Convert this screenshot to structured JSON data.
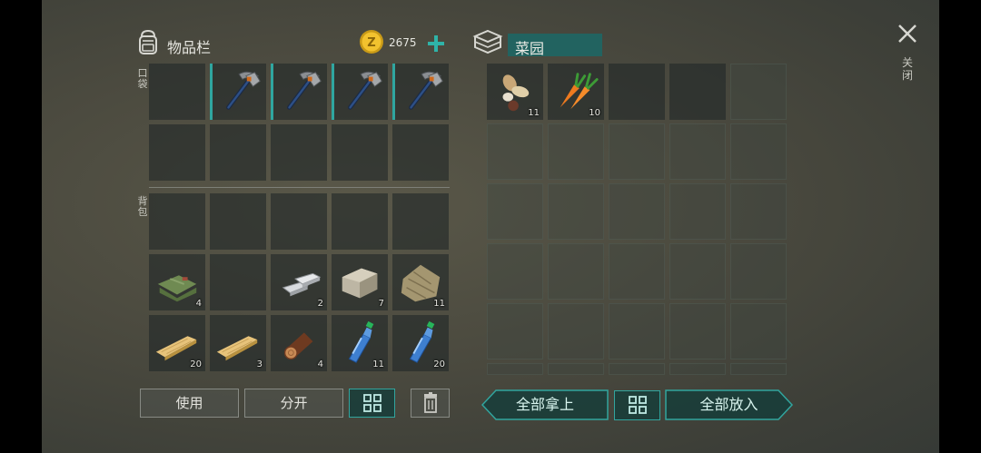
{
  "inventory": {
    "title": "物品栏",
    "currency_amount": "2675",
    "pocket_label": "口袋",
    "backpack_label": "背包",
    "pocket_slots": [
      {
        "item": "",
        "count": ""
      },
      {
        "item": "pickaxe",
        "count": ""
      },
      {
        "item": "pickaxe",
        "count": ""
      },
      {
        "item": "pickaxe",
        "count": ""
      },
      {
        "item": "pickaxe",
        "count": ""
      },
      {
        "item": "",
        "count": ""
      },
      {
        "item": "",
        "count": ""
      },
      {
        "item": "",
        "count": ""
      },
      {
        "item": "",
        "count": ""
      },
      {
        "item": "",
        "count": ""
      }
    ],
    "backpack_slots": [
      {
        "item": "",
        "count": ""
      },
      {
        "item": "",
        "count": ""
      },
      {
        "item": "",
        "count": ""
      },
      {
        "item": "",
        "count": ""
      },
      {
        "item": "",
        "count": ""
      },
      {
        "item": "cloth",
        "count": "4"
      },
      {
        "item": "",
        "count": ""
      },
      {
        "item": "iron-bars",
        "count": "2"
      },
      {
        "item": "stone",
        "count": "7"
      },
      {
        "item": "plant-fiber",
        "count": "11"
      },
      {
        "item": "plank",
        "count": "20"
      },
      {
        "item": "plank",
        "count": "3"
      },
      {
        "item": "log",
        "count": "4"
      },
      {
        "item": "water-bottle",
        "count": "11"
      },
      {
        "item": "water-bottle",
        "count": "20"
      }
    ],
    "buttons": {
      "use": "使用",
      "split": "分开"
    }
  },
  "garden": {
    "title": "菜园",
    "slots": [
      {
        "item": "seeds",
        "count": "11"
      },
      {
        "item": "carrot",
        "count": "10"
      }
    ],
    "buttons": {
      "take_all": "全部拿上",
      "put_all": "全部放入"
    }
  },
  "close_label": "关闭",
  "colors": {
    "accent": "#31a59e",
    "coin": "#e2b423",
    "plus": "#2fb3a8"
  }
}
